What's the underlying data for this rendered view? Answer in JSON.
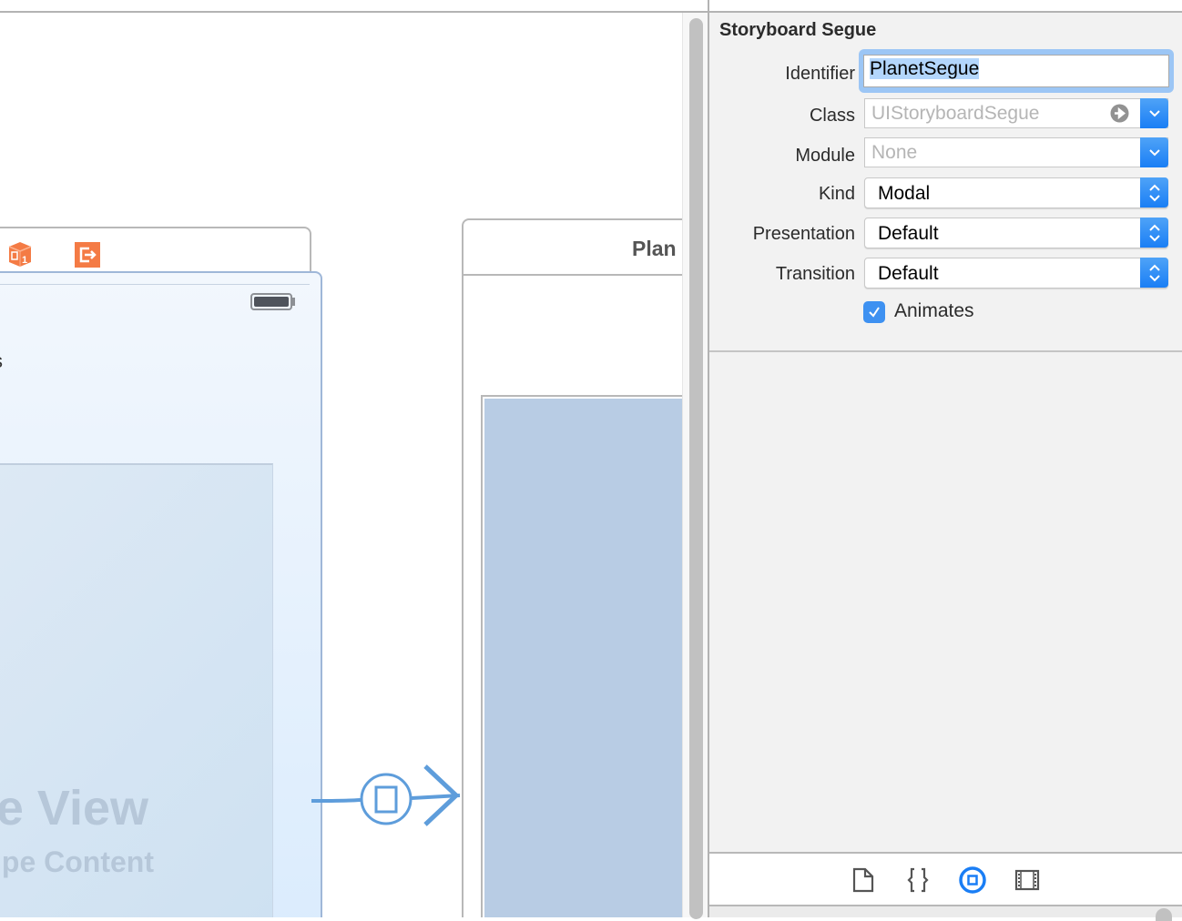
{
  "canvas": {
    "source_scene": {
      "partial_label": "s",
      "title_partial": "e View",
      "subtitle_partial": "pe Content"
    },
    "destination_scene": {
      "title_partial": "Plan"
    },
    "segue_icon": "modal-segue-icon"
  },
  "inspector": {
    "section_title": "Storyboard Segue",
    "fields": {
      "identifier": {
        "label": "Identifier",
        "value": "PlanetSegue"
      },
      "class": {
        "label": "Class",
        "placeholder": "UIStoryboardSegue"
      },
      "module": {
        "label": "Module",
        "placeholder": "None"
      },
      "kind": {
        "label": "Kind",
        "value": "Modal"
      },
      "presentation": {
        "label": "Presentation",
        "value": "Default"
      },
      "transition": {
        "label": "Transition",
        "value": "Default"
      },
      "animates": {
        "label": "Animates",
        "checked": true
      }
    },
    "library_tabs": [
      "file-template-icon",
      "code-snippet-icon",
      "object-library-icon",
      "media-library-icon"
    ],
    "selected_tab": "object-library-icon",
    "accent": "#1a7ef5"
  }
}
